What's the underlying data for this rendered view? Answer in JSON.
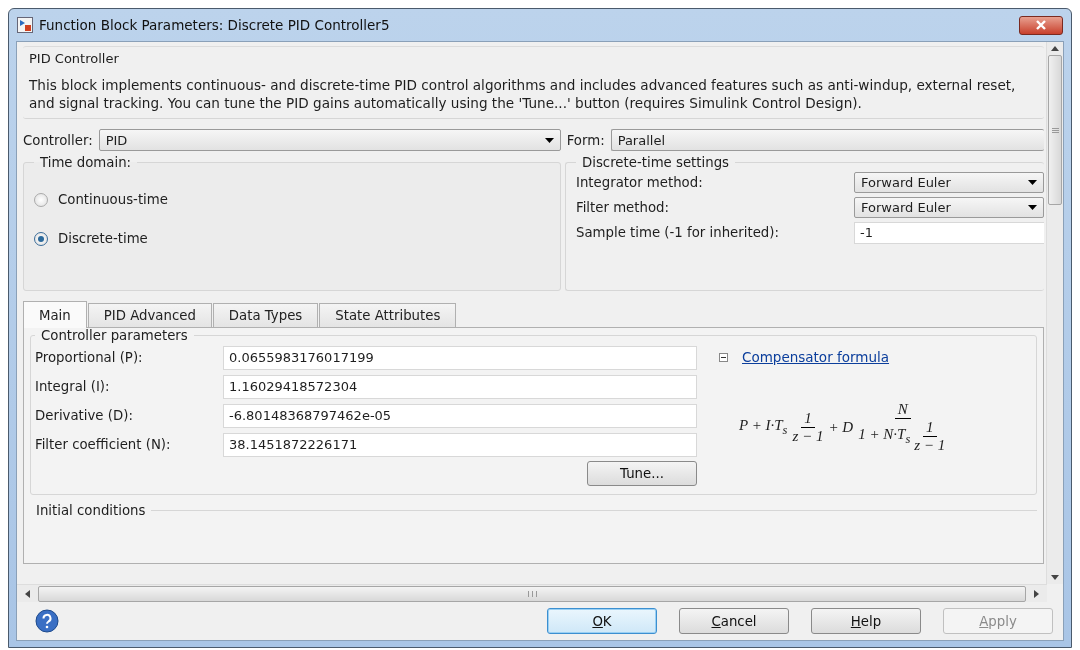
{
  "window": {
    "title": "Function Block Parameters: Discrete PID Controller5"
  },
  "block": {
    "name": "PID Controller",
    "description": "This block implements continuous- and discrete-time PID control algorithms and includes advanced features such as anti-windup, external reset, and signal tracking. You can tune the PID gains automatically using the 'Tune...' button (requires Simulink Control Design)."
  },
  "controller": {
    "label": "Controller:",
    "value": "PID"
  },
  "form": {
    "label": "Form:",
    "value": "Parallel"
  },
  "time_domain": {
    "title": "Time domain:",
    "options": [
      {
        "label": "Continuous-time",
        "selected": false
      },
      {
        "label": "Discrete-time",
        "selected": true
      }
    ]
  },
  "discrete_settings": {
    "title": "Discrete-time settings",
    "rows": [
      {
        "kind": "dropdown",
        "label": "Integrator method:",
        "value": "Forward Euler"
      },
      {
        "kind": "dropdown",
        "label": "Filter method:",
        "value": "Forward Euler"
      },
      {
        "kind": "input",
        "label": "Sample time (-1 for inherited):",
        "value": "-1"
      }
    ]
  },
  "tabs": [
    {
      "label": "Main",
      "selected": true
    },
    {
      "label": "PID Advanced",
      "selected": false
    },
    {
      "label": "Data Types",
      "selected": false
    },
    {
      "label": "State Attributes",
      "selected": false
    }
  ],
  "controller_parameters": {
    "title": "Controller parameters",
    "fields": [
      {
        "label": "Proportional (P):",
        "value": "0.0655983176017199"
      },
      {
        "label": "Integral (I):",
        "value": "1.16029418572304"
      },
      {
        "label": "Derivative (D):",
        "value": "-6.80148368797462e-05"
      },
      {
        "label": "Filter coefficient (N):",
        "value": "38.1451872226171"
      }
    ],
    "tune_button": "Tune...",
    "compensator": {
      "link": "Compensator formula",
      "expanded": true,
      "formula": {
        "term1": "P + I·T$_{s}$",
        "frac1_num": "1",
        "frac1_den": "z − 1",
        "term2": "+ D",
        "frac2_num": "N",
        "frac2_den_lead": "1 + N·T$_{s}$",
        "frac2_den_num": "1",
        "frac2_den_den": "z − 1"
      }
    }
  },
  "initial_conditions": {
    "title": "Initial conditions"
  },
  "buttons": [
    {
      "label": "OK",
      "default": true,
      "disabled": false
    },
    {
      "label": "Cancel",
      "default": false,
      "disabled": false
    },
    {
      "label": "Help",
      "default": false,
      "disabled": false
    },
    {
      "label": "Apply",
      "default": false,
      "disabled": true
    }
  ]
}
